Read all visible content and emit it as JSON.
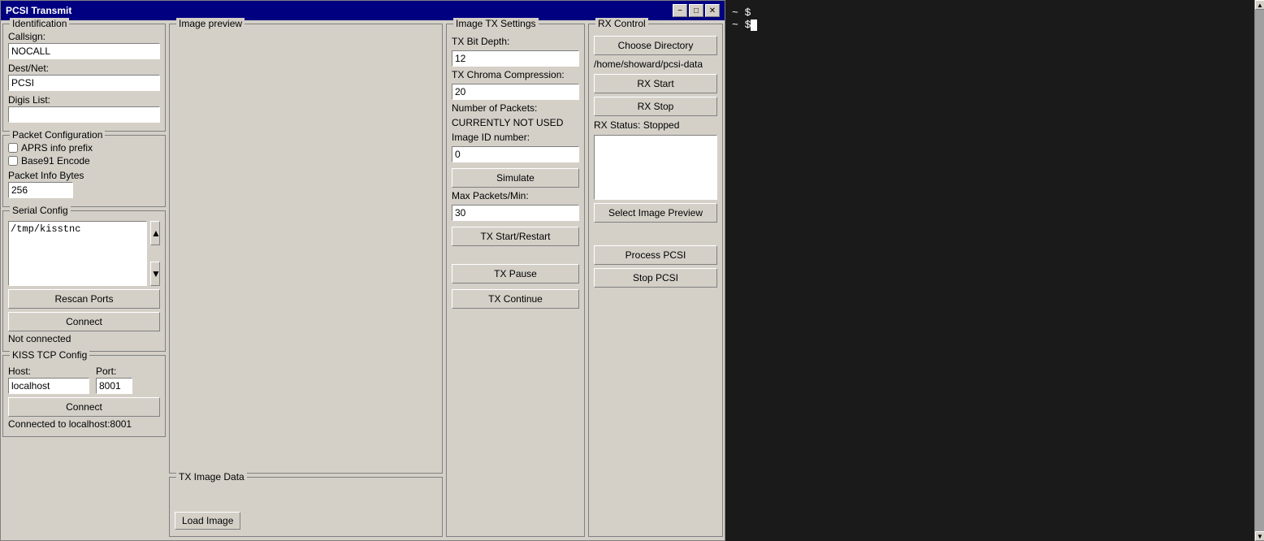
{
  "window": {
    "title": "PCSI Transmit",
    "minimize_label": "−",
    "maximize_label": "□",
    "close_label": "✕"
  },
  "identification": {
    "group_title": "Identification",
    "callsign_label": "Callsign:",
    "callsign_value": "NOCALL",
    "dest_net_label": "Dest/Net:",
    "dest_net_value": "PCSI",
    "digis_label": "Digis List:",
    "digis_value": ""
  },
  "packet_config": {
    "group_title": "Packet Configuration",
    "aprs_label": "APRS info prefix",
    "base91_label": "Base91 Encode",
    "packet_bytes_label": "Packet Info Bytes",
    "packet_bytes_value": "256"
  },
  "serial_config": {
    "group_title": "Serial Config",
    "port_value": "/tmp/kisstnc",
    "rescan_label": "Rescan Ports",
    "connect_label": "Connect",
    "status": "Not connected"
  },
  "kiss_tcp": {
    "group_title": "KISS TCP Config",
    "host_label": "Host:",
    "host_value": "localhost",
    "port_label": "Port:",
    "port_value": "8001",
    "connect_label": "Connect",
    "status": "Connected to localhost:8001"
  },
  "image_preview": {
    "group_title": "Image preview",
    "load_image_label": "Load Image"
  },
  "tx_image_data": {
    "group_title": "TX Image Data"
  },
  "tx_settings": {
    "group_title": "Image TX Settings",
    "bit_depth_label": "TX Bit Depth:",
    "bit_depth_value": "12",
    "chroma_label": "TX Chroma Compression:",
    "chroma_value": "20",
    "num_packets_label": "Number of Packets:",
    "num_packets_value": "CURRENTLY NOT USED",
    "image_id_label": "Image ID number:",
    "image_id_value": "0",
    "simulate_label": "Simulate",
    "max_packets_label": "Max Packets/Min:",
    "max_packets_value": "30",
    "tx_start_label": "TX Start/Restart",
    "tx_pause_label": "TX Pause",
    "tx_continue_label": "TX Continue"
  },
  "rx_control": {
    "group_title": "RX Control",
    "choose_dir_label": "Choose Directory",
    "dir_path": "/home/showard/pcsi-data",
    "rx_start_label": "RX Start",
    "rx_stop_label": "RX Stop",
    "rx_status": "RX Status: Stopped",
    "select_preview_label": "Select Image Preview",
    "process_pcsi_label": "Process PCSI",
    "stop_pcsi_label": "Stop PCSI"
  },
  "terminal": {
    "line1": "~ $",
    "line2": "~ $"
  }
}
